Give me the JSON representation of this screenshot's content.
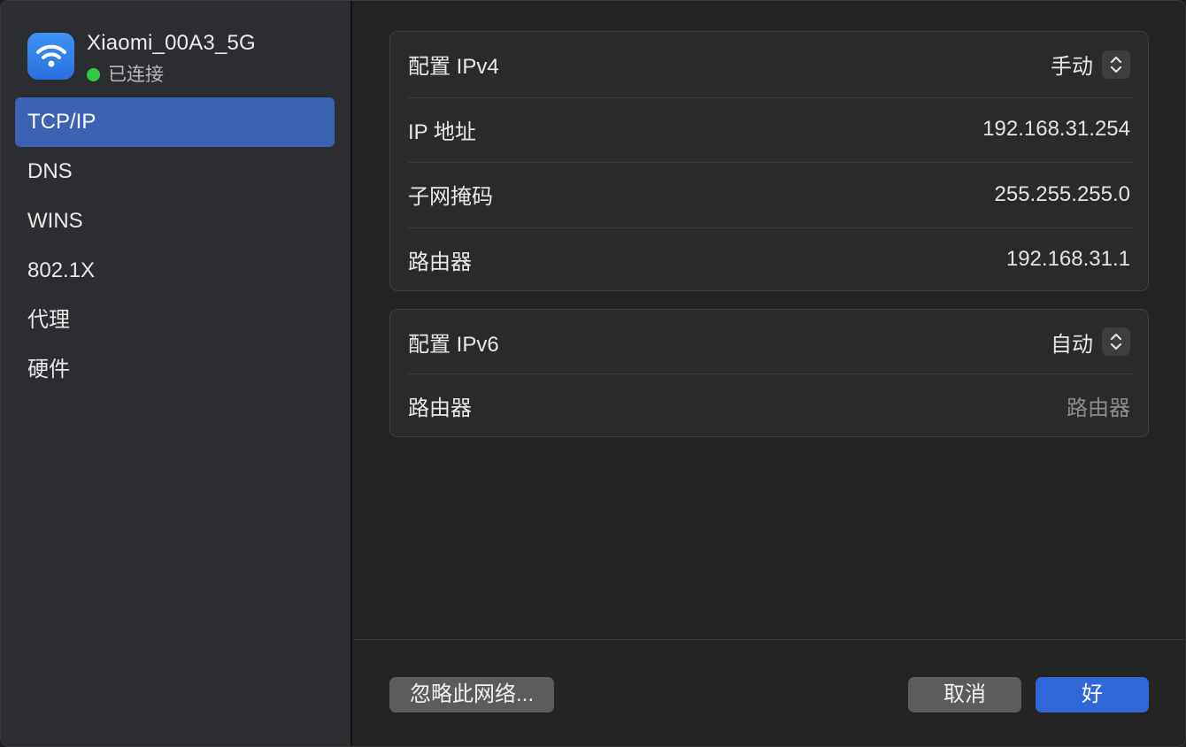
{
  "network": {
    "name": "Xiaomi_00A3_5G",
    "status": "已连接",
    "icon": "wifi-icon",
    "status_color": "#33c748"
  },
  "sidebar": {
    "items": [
      {
        "label": "TCP/IP",
        "active": true
      },
      {
        "label": "DNS"
      },
      {
        "label": "WINS"
      },
      {
        "label": "802.1X"
      },
      {
        "label": "代理"
      },
      {
        "label": "硬件"
      }
    ]
  },
  "ipv4": {
    "configure_label": "配置 IPv4",
    "configure_value": "手动",
    "ip_label": "IP 地址",
    "ip_value": "192.168.31.254",
    "subnet_label": "子网掩码",
    "subnet_value": "255.255.255.0",
    "router_label": "路由器",
    "router_value": "192.168.31.1"
  },
  "ipv6": {
    "configure_label": "配置 IPv6",
    "configure_value": "自动",
    "router_label": "路由器",
    "router_placeholder": "路由器"
  },
  "footer": {
    "forget_label": "忽略此网络...",
    "cancel_label": "取消",
    "ok_label": "好"
  },
  "colors": {
    "accent": "#3b62b3",
    "primary_button": "#2f67d8"
  }
}
